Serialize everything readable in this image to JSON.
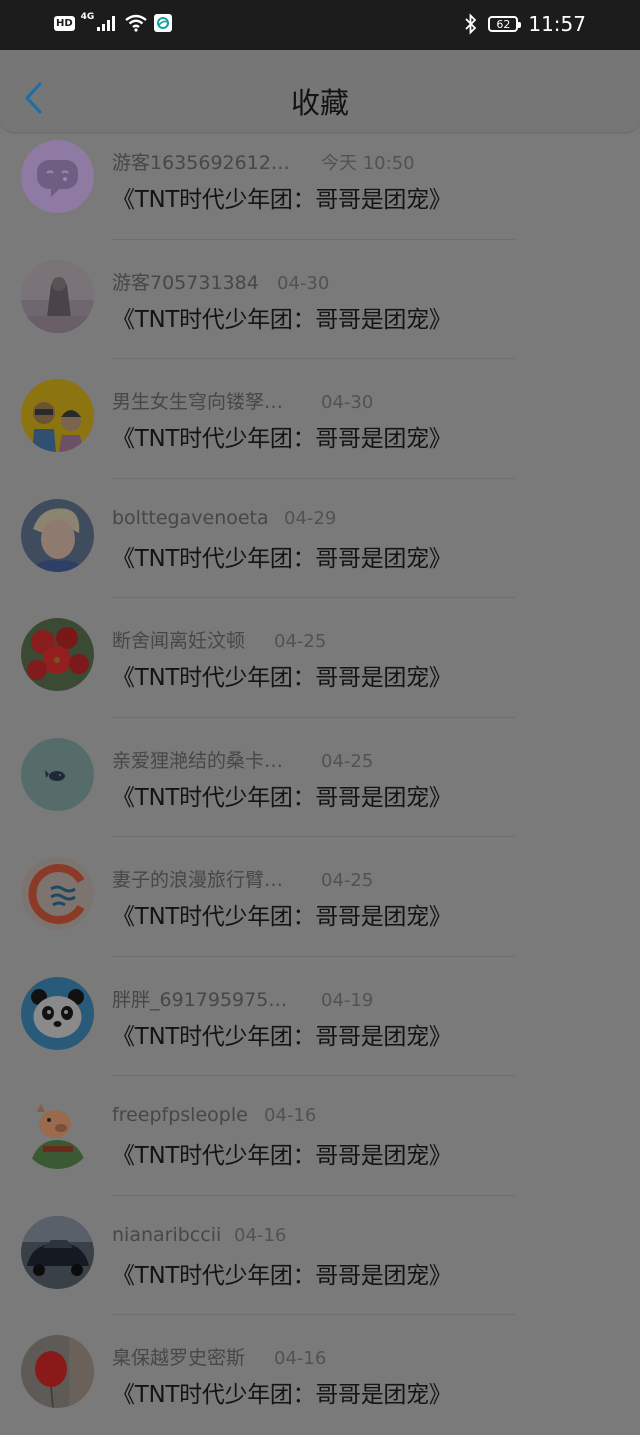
{
  "status_bar": {
    "hd": "HD",
    "network": "4G",
    "battery": "62",
    "time": "11:57",
    "icons": [
      "signal-icon",
      "wifi-icon",
      "carrier-icon",
      "bluetooth-icon",
      "battery-icon"
    ]
  },
  "header": {
    "title": "收藏",
    "back_icon": "chevron-left-icon",
    "accent": "#1f6fa6"
  },
  "items": [
    {
      "name": "游客1635692612…",
      "time": "今天 10:50",
      "title": "《TNT时代少年团：哥哥是团宠》",
      "avatar": "chat-bubble-avatar"
    },
    {
      "name": "游客705731384",
      "time": "04-30",
      "title": "《TNT时代少年团：哥哥是团宠》",
      "avatar": "photo-avatar"
    },
    {
      "name": "男生女生穹向镂孥…",
      "time": "04-30",
      "title": "《TNT时代少年团：哥哥是团宠》",
      "avatar": "cartoon-couple-avatar"
    },
    {
      "name": "bolttegavenoeta",
      "time": "04-29",
      "title": "《TNT时代少年团：哥哥是团宠》",
      "avatar": "portrait-avatar"
    },
    {
      "name": "断舍闻离妊汶顿",
      "time": "04-25",
      "title": "《TNT时代少年团：哥哥是团宠》",
      "avatar": "red-flower-avatar"
    },
    {
      "name": "亲爱狸滟结的桑卡…",
      "time": "04-25",
      "title": "《TNT时代少年团：哥哥是团宠》",
      "avatar": "whale-avatar"
    },
    {
      "name": "妻子的浪漫旅行臂…",
      "time": "04-25",
      "title": "《TNT时代少年团：哥哥是团宠》",
      "avatar": "waves-logo-avatar"
    },
    {
      "name": "胖胖_691795975…",
      "time": "04-19",
      "title": "《TNT时代少年团：哥哥是团宠》",
      "avatar": "panda-avatar"
    },
    {
      "name": "freepfpsleople",
      "time": "04-16",
      "title": "《TNT时代少年团：哥哥是团宠》",
      "avatar": "pig-warrior-avatar"
    },
    {
      "name": "nianaribccii",
      "time": "04-16",
      "title": "《TNT时代少年团：哥哥是团宠》",
      "avatar": "car-avatar"
    },
    {
      "name": "臬保越罗史密斯",
      "time": "04-16",
      "title": "《TNT时代少年团：哥哥是团宠》",
      "avatar": "balloon-avatar"
    }
  ]
}
